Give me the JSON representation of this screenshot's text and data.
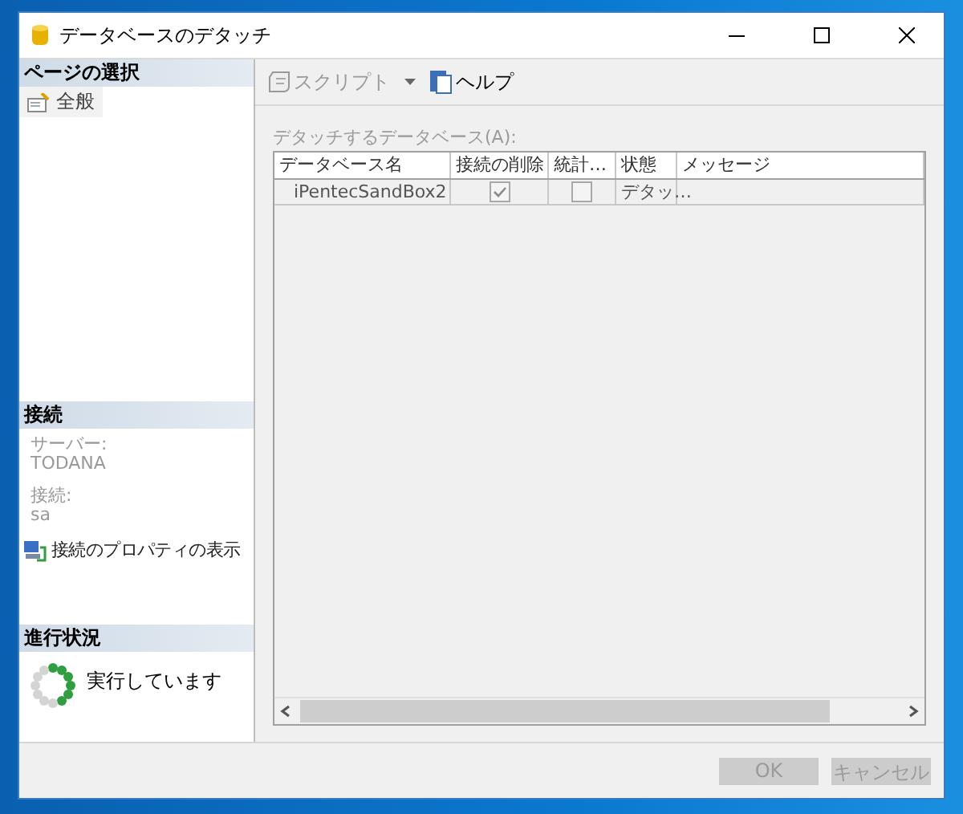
{
  "window": {
    "title": "データベースのデタッチ"
  },
  "sidebar": {
    "pages_header": "ページの選択",
    "pages": [
      {
        "label": "全般",
        "selected": true
      }
    ],
    "connection_header": "接続",
    "server_label": "サーバー:",
    "server": "TODANA",
    "connection_label": "接続:",
    "connection": "sa",
    "properties_link": "接続のプロパティの表示",
    "progress_header": "進行状況",
    "progress_status": "実行しています"
  },
  "toolbar": {
    "script_button": {
      "label": "スクリプト",
      "disabled": true
    },
    "help_button": {
      "label": "ヘルプ",
      "disabled": false
    }
  },
  "grid": {
    "label": "デタッチするデータベース(A):",
    "columns": [
      "データベース名",
      "接続の削除",
      "統計…",
      "状態",
      "メッセージ"
    ],
    "rows": [
      {
        "name": "iPentecSandBox2",
        "drop_connections": true,
        "update_statistics": false,
        "status": "デタッ…"
      }
    ]
  },
  "buttons": [
    {
      "label": "OK",
      "disabled": true
    },
    {
      "label": "キャンセル",
      "disabled": true
    }
  ]
}
